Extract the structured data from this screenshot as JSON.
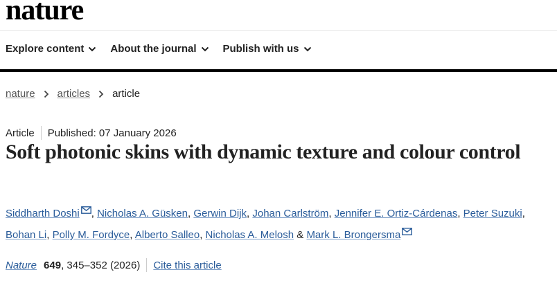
{
  "site": {
    "logo": "nature"
  },
  "nav": {
    "items": [
      {
        "label": "Explore content"
      },
      {
        "label": "About the journal"
      },
      {
        "label": "Publish with us"
      }
    ]
  },
  "breadcrumb": {
    "items": [
      "nature",
      "articles"
    ],
    "current": "article"
  },
  "article": {
    "type": "Article",
    "published": "Published: 07 January 2026",
    "title": "Soft photonic skins with dynamic texture and colour control",
    "authors": [
      {
        "name": "Siddharth Doshi",
        "mail": true
      },
      {
        "name": "Nicholas A. Güsken"
      },
      {
        "name": "Gerwin Dijk"
      },
      {
        "name": "Johan Carlström"
      },
      {
        "name": "Jennifer E. Ortiz-Cárdenas"
      },
      {
        "name": "Peter Suzuki"
      },
      {
        "name": "Bohan Li"
      },
      {
        "name": "Polly M. Fordyce"
      },
      {
        "name": "Alberto Salleo"
      },
      {
        "name": "Nicholas A. Melosh"
      },
      {
        "name": "Mark L. Brongersma",
        "mail": true
      }
    ],
    "author_separator": ", ",
    "author_and": " & ",
    "citation": {
      "journal": "Nature",
      "volume": "649",
      "pages_year": ", 345–352 (2026)",
      "cite_label": "Cite this article"
    }
  },
  "colors": {
    "link": "#2a5c9a",
    "text": "#222222",
    "rule": "#000000"
  },
  "icons": {
    "nav_chevron": "chevron-down-icon",
    "breadcrumb_sep": "chevron-right-icon",
    "corresponding": "mail-icon"
  }
}
